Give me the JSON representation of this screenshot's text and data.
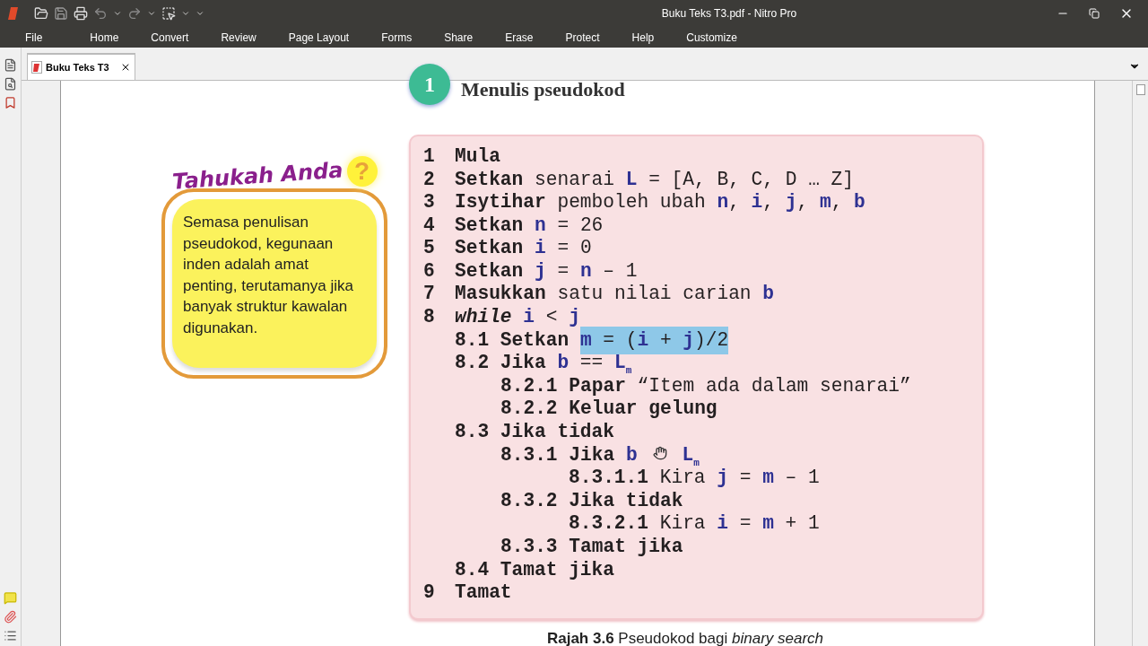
{
  "window": {
    "title": "Buku Teks T3.pdf - Nitro Pro"
  },
  "menu": [
    "File",
    "Home",
    "Convert",
    "Review",
    "Page Layout",
    "Forms",
    "Share",
    "Erase",
    "Protect",
    "Help",
    "Customize"
  ],
  "tabs": [
    {
      "label": "Buku Teks T3",
      "selected": true
    }
  ],
  "page": {
    "section_number": "1",
    "section_title": "Menulis pseudokod",
    "callout": {
      "title": "Tahukah Anda",
      "mark": "?",
      "body": "Semasa penulisan pseudokod, kegunaan inden adalah amat penting, terutamanya jika banyak struktur kawalan digunakan."
    },
    "code": [
      {
        "number": "1",
        "segments": [
          {
            "kind": "keyword",
            "text": "Mula"
          }
        ]
      },
      {
        "number": "2",
        "segments": [
          {
            "kind": "keyword",
            "text": "Setkan"
          },
          {
            "kind": "plain",
            "text": " senarai "
          },
          {
            "kind": "var",
            "text": "L"
          },
          {
            "kind": "plain",
            "text": " = [A, B, C, D … Z]"
          }
        ]
      },
      {
        "number": "3",
        "segments": [
          {
            "kind": "keyword",
            "text": "Isytihar"
          },
          {
            "kind": "plain",
            "text": " pemboleh ubah "
          },
          {
            "kind": "var",
            "text": "n"
          },
          {
            "kind": "plain",
            "text": ", "
          },
          {
            "kind": "var",
            "text": "i"
          },
          {
            "kind": "plain",
            "text": ", "
          },
          {
            "kind": "var",
            "text": "j"
          },
          {
            "kind": "plain",
            "text": ", "
          },
          {
            "kind": "var",
            "text": "m"
          },
          {
            "kind": "plain",
            "text": ", "
          },
          {
            "kind": "var",
            "text": "b"
          }
        ]
      },
      {
        "number": "4",
        "segments": [
          {
            "kind": "keyword",
            "text": "Setkan"
          },
          {
            "kind": "space"
          },
          {
            "kind": "var",
            "text": "n"
          },
          {
            "kind": "plain",
            "text": " = 26"
          }
        ]
      },
      {
        "number": "5",
        "segments": [
          {
            "kind": "keyword",
            "text": "Setkan"
          },
          {
            "kind": "space"
          },
          {
            "kind": "var",
            "text": "i"
          },
          {
            "kind": "plain",
            "text": " = 0"
          }
        ]
      },
      {
        "number": "6",
        "segments": [
          {
            "kind": "keyword",
            "text": "Setkan"
          },
          {
            "kind": "space"
          },
          {
            "kind": "var",
            "text": "j"
          },
          {
            "kind": "plain",
            "text": " = "
          },
          {
            "kind": "var",
            "text": "n"
          },
          {
            "kind": "plain",
            "text": " – 1"
          }
        ]
      },
      {
        "number": "7",
        "segments": [
          {
            "kind": "keyword",
            "text": "Masukkan"
          },
          {
            "kind": "plain",
            "text": " satu nilai carian "
          },
          {
            "kind": "var",
            "text": "b"
          }
        ]
      },
      {
        "number": "8",
        "segments": [
          {
            "kind": "italic-keyword",
            "text": "while"
          },
          {
            "kind": "space"
          },
          {
            "kind": "var",
            "text": "i"
          },
          {
            "kind": "plain",
            "text": " < "
          },
          {
            "kind": "var",
            "text": "j"
          }
        ],
        "children": [
          {
            "segments": [
              {
                "kind": "keyword",
                "text": "8.1 Setkan"
              },
              {
                "kind": "space"
              },
              {
                "kind": "selection",
                "parts": [
                  {
                    "kind": "var",
                    "text": "m"
                  },
                  {
                    "kind": "plain",
                    "text": " = ("
                  },
                  {
                    "kind": "var",
                    "text": "i"
                  },
                  {
                    "kind": "plain",
                    "text": " + "
                  },
                  {
                    "kind": "var",
                    "text": "j"
                  },
                  {
                    "kind": "plain",
                    "text": ")/2"
                  }
                ]
              }
            ]
          },
          {
            "segments": [
              {
                "kind": "keyword",
                "text": "8.2 Jika"
              },
              {
                "kind": "space"
              },
              {
                "kind": "var",
                "text": "b"
              },
              {
                "kind": "plain",
                "text": " == "
              },
              {
                "kind": "var",
                "text": "L"
              },
              {
                "kind": "sub",
                "text": "m"
              }
            ],
            "children": [
              {
                "segments": [
                  {
                    "kind": "keyword",
                    "text": "8.2.1 Papar"
                  },
                  {
                    "kind": "plain",
                    "text": " “Item ada dalam senarai”"
                  }
                ]
              },
              {
                "segments": [
                  {
                    "kind": "keyword",
                    "text": "8.2.2 Keluar gelung"
                  }
                ]
              }
            ]
          },
          {
            "segments": [
              {
                "kind": "keyword",
                "text": "8.3 Jika tidak"
              }
            ],
            "children": [
              {
                "segments": [
                  {
                    "kind": "keyword",
                    "text": "8.3.1 Jika"
                  },
                  {
                    "kind": "space"
                  },
                  {
                    "kind": "var",
                    "text": "b"
                  },
                  {
                    "kind": "cursor"
                  },
                  {
                    "kind": "var",
                    "text": "L"
                  },
                  {
                    "kind": "sub",
                    "text": "m"
                  }
                ],
                "children": [
                  {
                    "segments": [
                      {
                        "kind": "keyword",
                        "text": "8.3.1.1"
                      },
                      {
                        "kind": "plain",
                        "text": " Kira "
                      },
                      {
                        "kind": "var",
                        "text": "j"
                      },
                      {
                        "kind": "plain",
                        "text": " = "
                      },
                      {
                        "kind": "var",
                        "text": "m"
                      },
                      {
                        "kind": "plain",
                        "text": " – 1"
                      }
                    ]
                  }
                ]
              },
              {
                "segments": [
                  {
                    "kind": "keyword",
                    "text": "8.3.2 Jika tidak"
                  }
                ],
                "children": [
                  {
                    "segments": [
                      {
                        "kind": "keyword",
                        "text": "8.3.2.1"
                      },
                      {
                        "kind": "plain",
                        "text": " Kira "
                      },
                      {
                        "kind": "var",
                        "text": "i"
                      },
                      {
                        "kind": "plain",
                        "text": " = "
                      },
                      {
                        "kind": "var",
                        "text": "m"
                      },
                      {
                        "kind": "plain",
                        "text": " + 1"
                      }
                    ]
                  }
                ]
              },
              {
                "segments": [
                  {
                    "kind": "keyword",
                    "text": "8.3.3 Tamat jika"
                  }
                ]
              }
            ]
          },
          {
            "segments": [
              {
                "kind": "keyword",
                "text": "8.4 Tamat jika"
              }
            ]
          }
        ]
      },
      {
        "number": "9",
        "segments": [
          {
            "kind": "keyword",
            "text": "Tamat"
          }
        ]
      }
    ],
    "caption": "**Rajah 3.6** Pseudokod bagi *binary search*"
  }
}
